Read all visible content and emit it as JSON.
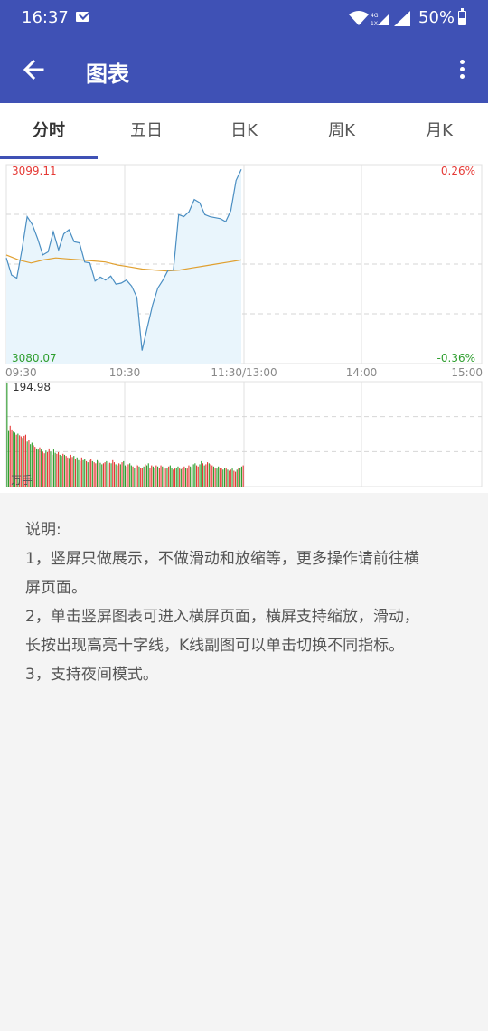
{
  "status_bar": {
    "time": "16:37",
    "battery": "50%",
    "icons": [
      "mail-icon",
      "wifi-icon",
      "signal-icon",
      "battery-icon"
    ]
  },
  "app_bar": {
    "title": "图表",
    "icons": [
      "arrow-back-icon",
      "more-vert-icon"
    ]
  },
  "tabs": [
    {
      "label": "分时",
      "active": true
    },
    {
      "label": "五日",
      "active": false
    },
    {
      "label": "日K",
      "active": false
    },
    {
      "label": "周K",
      "active": false
    },
    {
      "label": "月K",
      "active": false
    }
  ],
  "colors": {
    "primary": "#3f51b5",
    "up": "#e53935",
    "down": "#2e9e2e",
    "price_line": "#4a8ec2",
    "avg_line": "#e0a030"
  },
  "chart_data": {
    "type": "line",
    "price_labels": {
      "high": "3099.11",
      "low": "3080.07"
    },
    "percent_labels": {
      "high": "0.26%",
      "low": "-0.36%"
    },
    "time_labels": [
      "09:30",
      "10:30",
      "11:30/13:00",
      "14:00",
      "15:00"
    ],
    "ylim": [
      3080.07,
      3099.11
    ],
    "series": [
      {
        "values": [
          3090.2,
          3088.5,
          3088.2,
          3091.0,
          3094.3,
          3093.5,
          3092.1,
          3090.5,
          3090.8,
          3092.8,
          3091.0,
          3092.6,
          3093.0,
          3091.8,
          3091.7,
          3089.8,
          3089.7,
          3087.9,
          3088.3,
          3088.0,
          3088.4,
          3087.6,
          3087.7,
          3088.0,
          3087.4,
          3086.3,
          3081.0,
          3083.3,
          3085.5,
          3087.2,
          3088.0,
          3089.0,
          3089.0,
          3094.5,
          3094.3,
          3094.8,
          3096.0,
          3095.7,
          3094.5,
          3094.3,
          3094.2,
          3094.1,
          3093.8,
          3094.9,
          3097.9,
          3099.0
        ]
      },
      {
        "values": [
          3090.5,
          3090.0,
          3089.7,
          3090.0,
          3090.2,
          3090.1,
          3090.0,
          3089.9,
          3089.8,
          3089.5,
          3089.3,
          3089.1,
          3089.0,
          3088.9,
          3089.0,
          3089.2,
          3089.4,
          3089.6,
          3089.8,
          3090.0
        ]
      }
    ],
    "volume": {
      "max_label": "194.98",
      "unit_label": "万手",
      "values": [
        194.98,
        105,
        115,
        108,
        104,
        102,
        98,
        100,
        97,
        95,
        92,
        96,
        98,
        85,
        88,
        80,
        83,
        78,
        75,
        72,
        70,
        74,
        70,
        66,
        63,
        68,
        65,
        72,
        66,
        60,
        70,
        64,
        62,
        65,
        60,
        58,
        62,
        60,
        58,
        55,
        54,
        60,
        56,
        58,
        52,
        55,
        50,
        48,
        55,
        50,
        52,
        48,
        46,
        50,
        52,
        48,
        46,
        44,
        50,
        48,
        45,
        42,
        44,
        46,
        48,
        42,
        45,
        44,
        50,
        46,
        42,
        40,
        44,
        42,
        46,
        48,
        40,
        38,
        42,
        44,
        40,
        38,
        36,
        42,
        40,
        38,
        36,
        35,
        38,
        42,
        40,
        44,
        36,
        40,
        38,
        36,
        40,
        38,
        35,
        40,
        38,
        36,
        34,
        36,
        38,
        40,
        35,
        32,
        34,
        36,
        38,
        34,
        33,
        35,
        38,
        36,
        34,
        40,
        38,
        36,
        42,
        44,
        40,
        38,
        42,
        48,
        44,
        40,
        42,
        46,
        44,
        42,
        40,
        38,
        36,
        34,
        38,
        36,
        34,
        32,
        36,
        34,
        32,
        30,
        32,
        34,
        30,
        28,
        32,
        34,
        36,
        38,
        40
      ]
    }
  },
  "notes": {
    "title": "说明:",
    "lines": [
      "1，竖屏只做展示，不做滑动和放缩等，更多操作请前往横",
      "屏页面。",
      " 2，单击竖屏图表可进入横屏页面，横屏支持缩放，滑动，",
      "长按出现高亮十字线，K线副图可以单击切换不同指标。",
      " 3，支持夜间模式。"
    ]
  }
}
